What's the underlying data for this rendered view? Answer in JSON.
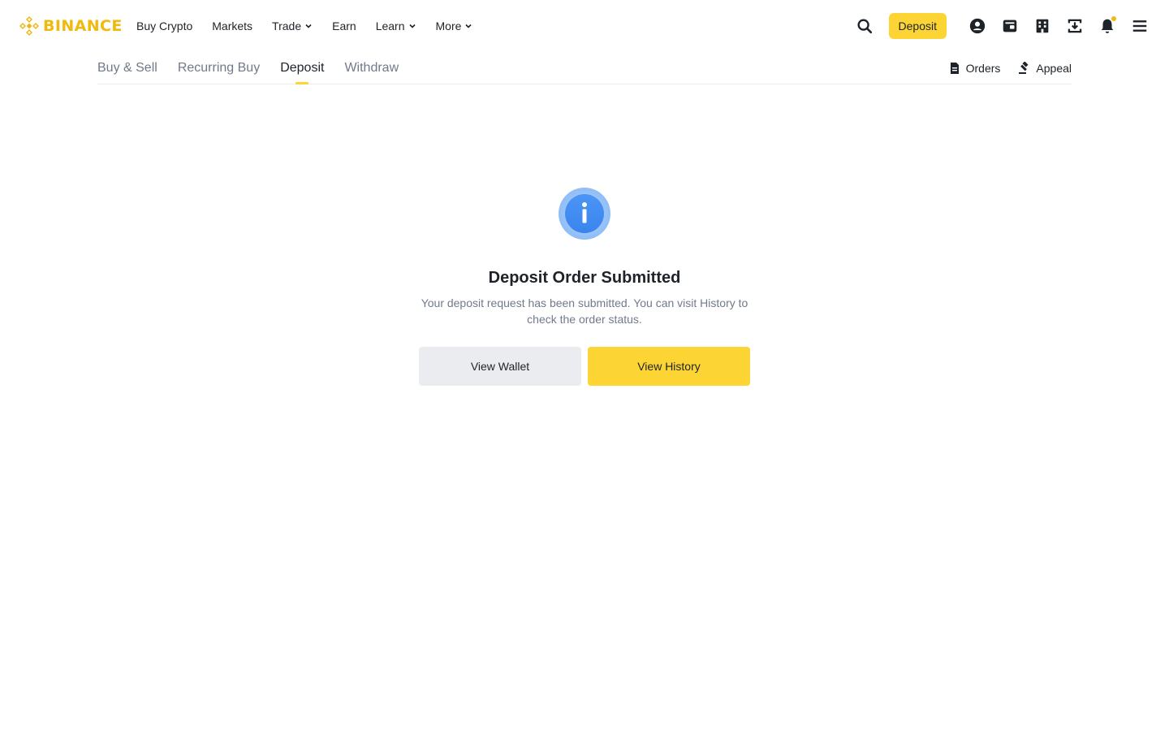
{
  "header": {
    "logo_text": "BINANCE",
    "nav": [
      {
        "label": "Buy Crypto",
        "dropdown": false
      },
      {
        "label": "Markets",
        "dropdown": false
      },
      {
        "label": "Trade",
        "dropdown": true
      },
      {
        "label": "Earn",
        "dropdown": false
      },
      {
        "label": "Learn",
        "dropdown": true
      },
      {
        "label": "More",
        "dropdown": true
      }
    ],
    "deposit_label": "Deposit",
    "icons": [
      "search-icon",
      "account-icon",
      "wallet-icon",
      "orders-icon",
      "download-icon",
      "notification-icon",
      "menu-icon"
    ]
  },
  "subnav": {
    "tabs": [
      {
        "label": "Buy & Sell",
        "active": false
      },
      {
        "label": "Recurring Buy",
        "active": false
      },
      {
        "label": "Deposit",
        "active": true
      },
      {
        "label": "Withdraw",
        "active": false
      }
    ],
    "orders_label": "Orders",
    "appeal_label": "Appeal"
  },
  "result": {
    "icon": "info-icon",
    "title": "Deposit Order Submitted",
    "description": "Your deposit request has been submitted. You can visit History to check the order status.",
    "secondary_button": "View Wallet",
    "primary_button": "View History"
  },
  "colors": {
    "brand_yellow": "#fcd535",
    "logo_yellow": "#f0b90b",
    "info_blue": "#3e8bf2",
    "text_primary": "#1e2329",
    "text_secondary": "#707a8a"
  }
}
